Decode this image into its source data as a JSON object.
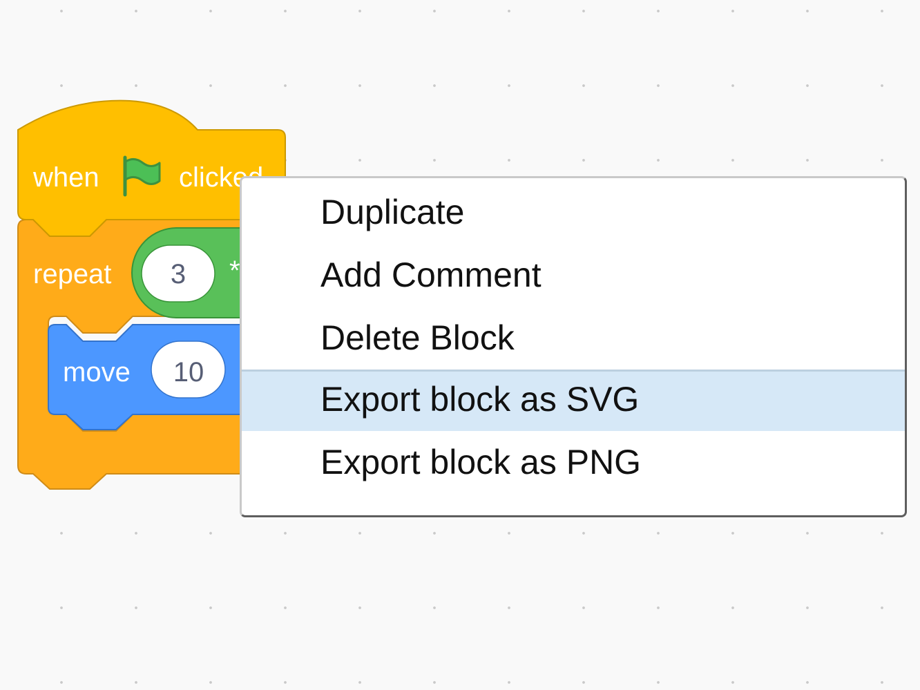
{
  "script": {
    "hat": {
      "prefix": "when",
      "icon": "green-flag-icon",
      "suffix": "clicked"
    },
    "repeat": {
      "label": "repeat",
      "count_value": "3",
      "operator_symbol": "*"
    },
    "move": {
      "label": "move",
      "steps_value": "10"
    }
  },
  "colors": {
    "events": "#ffbf00",
    "events_border": "#cc9900",
    "control": "#ffab19",
    "control_border": "#cf8b17",
    "operators": "#59c059",
    "operators_border": "#389438",
    "motion": "#4c97ff",
    "motion_border": "#3373cc",
    "field_text": "#575e75",
    "menu_highlight": "#d6e8f7"
  },
  "context_menu": {
    "items": [
      {
        "label": "Duplicate"
      },
      {
        "label": "Add Comment"
      },
      {
        "label": "Delete Block"
      },
      {
        "label": "Export block as SVG",
        "highlighted": true
      },
      {
        "label": "Export block as PNG"
      }
    ]
  }
}
